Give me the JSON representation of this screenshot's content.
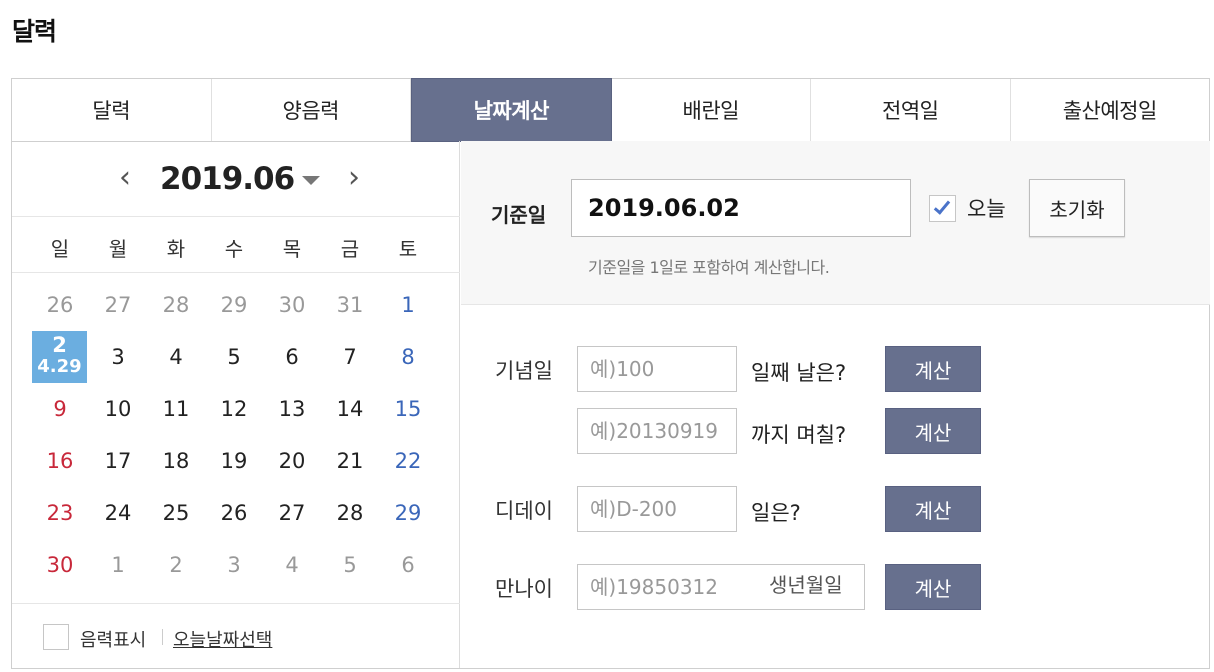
{
  "page": {
    "title": "달력"
  },
  "tabs": [
    {
      "label": "달력",
      "active": false
    },
    {
      "label": "양음력",
      "active": false
    },
    {
      "label": "날짜계산",
      "active": true
    },
    {
      "label": "배란일",
      "active": false
    },
    {
      "label": "전역일",
      "active": false
    },
    {
      "label": "출산예정일",
      "active": false
    }
  ],
  "calendar": {
    "prev_icon": "‹",
    "next_icon": "›",
    "month": "2019.06",
    "weekdays": [
      "일",
      "월",
      "화",
      "수",
      "목",
      "금",
      "토"
    ],
    "weeks": [
      [
        "26",
        "27",
        "28",
        "29",
        "30",
        "31",
        "1"
      ],
      [
        "2",
        "3",
        "4",
        "5",
        "6",
        "7",
        "8"
      ],
      [
        "9",
        "10",
        "11",
        "12",
        "13",
        "14",
        "15"
      ],
      [
        "16",
        "17",
        "18",
        "19",
        "20",
        "21",
        "22"
      ],
      [
        "23",
        "24",
        "25",
        "26",
        "27",
        "28",
        "29"
      ],
      [
        "30",
        "1",
        "2",
        "3",
        "4",
        "5",
        "6"
      ]
    ],
    "selected_day": "2",
    "selected_lunar": "4.29",
    "show_lunar_label": "음력표시",
    "select_today_label": "오늘날짜선택"
  },
  "base": {
    "label": "기준일",
    "value": "2019.06.02",
    "today_label": "오늘",
    "today_checked": true,
    "reset_label": "초기화",
    "note": "기준일을 1일로 포함하여 계산합니다."
  },
  "calcs": {
    "anniversary": {
      "label": "기념일",
      "placeholder": "예)100",
      "suffix": "일째 날은?",
      "button": "계산"
    },
    "until": {
      "placeholder": "예)20130919",
      "suffix": "까지 며칠?",
      "button": "계산"
    },
    "dday": {
      "label": "디데이",
      "placeholder": "예)D-200",
      "suffix": "일은?",
      "button": "계산"
    },
    "age": {
      "label": "만나이",
      "placeholder": "예)19850312",
      "hint": "생년월일",
      "button": "계산"
    }
  }
}
